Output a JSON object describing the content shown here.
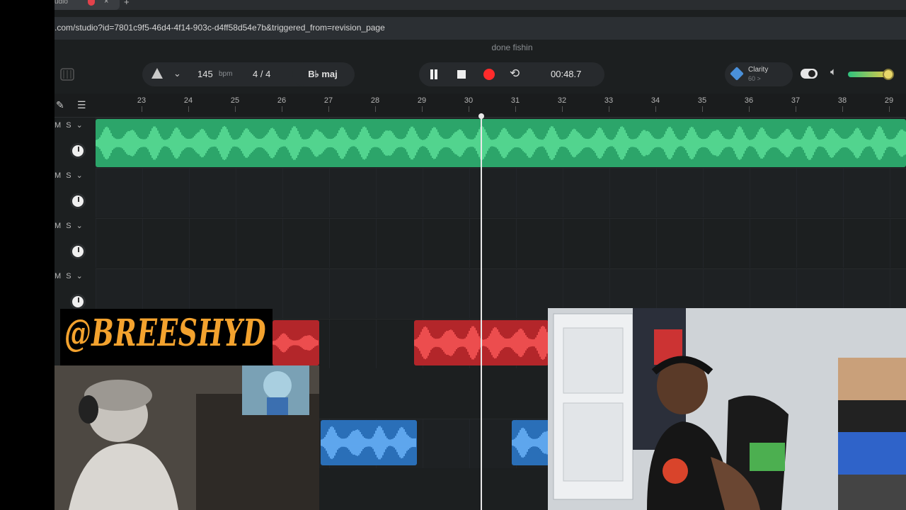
{
  "browser": {
    "tab_title": "udio",
    "close_glyph": "×",
    "new_tab_glyph": "+",
    "url": ".com/studio?id=7801c9f5-46d4-4f14-903c-d4ff58d54e7b&triggered_from=revision_page"
  },
  "project": {
    "name": "done fishin"
  },
  "toolbar": {
    "bpm_value": "145",
    "bpm_unit": "bpm",
    "time_signature": "4 / 4",
    "key": "B♭ maj",
    "time_display": "00:48.7",
    "clarity_label": "Clarity",
    "clarity_sub": "60 >",
    "clarity_enabled": true,
    "volume_level": 0.9,
    "icons": {
      "grid": "grid-icon",
      "metronome": "metronome-icon",
      "chevron": "chevron-down-icon",
      "pause": "pause-icon",
      "stop": "stop-icon",
      "record": "record-icon",
      "loop": "loop-icon",
      "clarity": "diamond-icon",
      "volume": "speaker-icon"
    }
  },
  "ruler": {
    "bars": [
      "23",
      "24",
      "25",
      "26",
      "27",
      "28",
      "29",
      "30",
      "31",
      "32",
      "33",
      "34",
      "35",
      "36",
      "37",
      "38",
      "29"
    ],
    "tools": [
      "pencil-icon",
      "tracks-icon"
    ]
  },
  "tracks": [
    {
      "buttons": "M S ⌄",
      "clip_color": "green"
    },
    {
      "buttons": "M S ⌄",
      "clip_color": "none"
    },
    {
      "buttons": "M S ⌄",
      "clip_color": "none"
    },
    {
      "buttons": "M S ⌄",
      "clip_color": "none"
    },
    {
      "buttons": "",
      "clip_color": "red"
    },
    {
      "buttons": "",
      "clip_color": "blue"
    }
  ],
  "playhead_bar": "30",
  "overlay": {
    "handle": "@BREESHYD"
  },
  "colors": {
    "app_bg": "#1c1f20",
    "green_clip": "#2ca56a",
    "green_wave": "#5ee39b",
    "red_clip": "#b3262a",
    "red_wave": "#ff5a5a",
    "blue_clip": "#2a6fb8",
    "blue_wave": "#6fb8ff",
    "record": "#ff2b2b",
    "handle_text": "#f3a22e"
  }
}
